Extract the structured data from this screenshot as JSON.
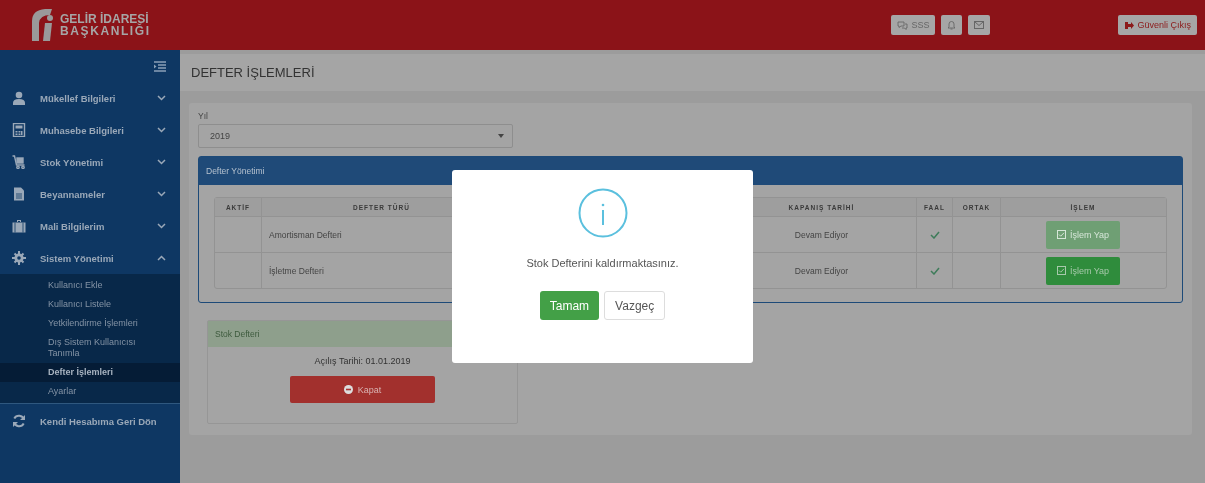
{
  "header": {
    "logo_lines": [
      "GELİR İDARESİ",
      "BAŞKANLIĞI"
    ],
    "buttons": [
      {
        "kind": "faq",
        "label": "SSS"
      },
      {
        "kind": "bell"
      },
      {
        "kind": "mail"
      }
    ],
    "logout": "Güvenli Çıkış"
  },
  "sidebar": {
    "items": [
      {
        "label": "Mükellef Bilgileri",
        "expanded": false
      },
      {
        "label": "Muhasebe Bilgileri",
        "expanded": false
      },
      {
        "label": "Stok Yönetimi",
        "expanded": false
      },
      {
        "label": "Beyannameler",
        "expanded": false
      },
      {
        "label": "Mali Bilgilerim",
        "expanded": false
      },
      {
        "label": "Sistem Yönetimi",
        "expanded": true,
        "children": [
          {
            "label": "Kullanıcı Ekle",
            "selected": false
          },
          {
            "label": "Kullanıcı Listele",
            "selected": false
          },
          {
            "label": "Yetkilendirme İşlemleri",
            "selected": false
          },
          {
            "label": "Dış Sistem Kullanıcısı Tanımla",
            "selected": false
          },
          {
            "label": "Defter İşlemleri",
            "selected": true
          },
          {
            "label": "Ayarlar",
            "selected": false
          }
        ]
      }
    ],
    "footer": "Kendi Hesabıma Geri Dön"
  },
  "page_title": "DEFTER İŞLEMLERİ",
  "year_field": {
    "label": "Yıl",
    "value": "2019"
  },
  "defter_panel": {
    "title": "Defter Yönetimi",
    "columns": [
      "AKTİF",
      "DEFTER TÜRÜ",
      "KAPANIŞ TARİHİ",
      "FAAL",
      "ORTAK",
      "İŞLEM"
    ],
    "rows": [
      {
        "type": "Amortisman Defteri",
        "closing": "Devam Ediyor",
        "faal": true,
        "action": "İşlem Yap",
        "disabled": true
      },
      {
        "type": "İşletme Defteri",
        "closing": "Devam Ediyor",
        "faal": true,
        "action": "İşlem Yap",
        "disabled": false
      }
    ]
  },
  "stock_card": {
    "title": "Stok Defteri",
    "opening": "Açılış Tarihi: 01.01.2019",
    "button": "Kapat"
  },
  "dialog": {
    "message": "Stok Defterini kaldırmaktasınız.",
    "confirm": "Tamam",
    "cancel": "Vazgeç"
  }
}
